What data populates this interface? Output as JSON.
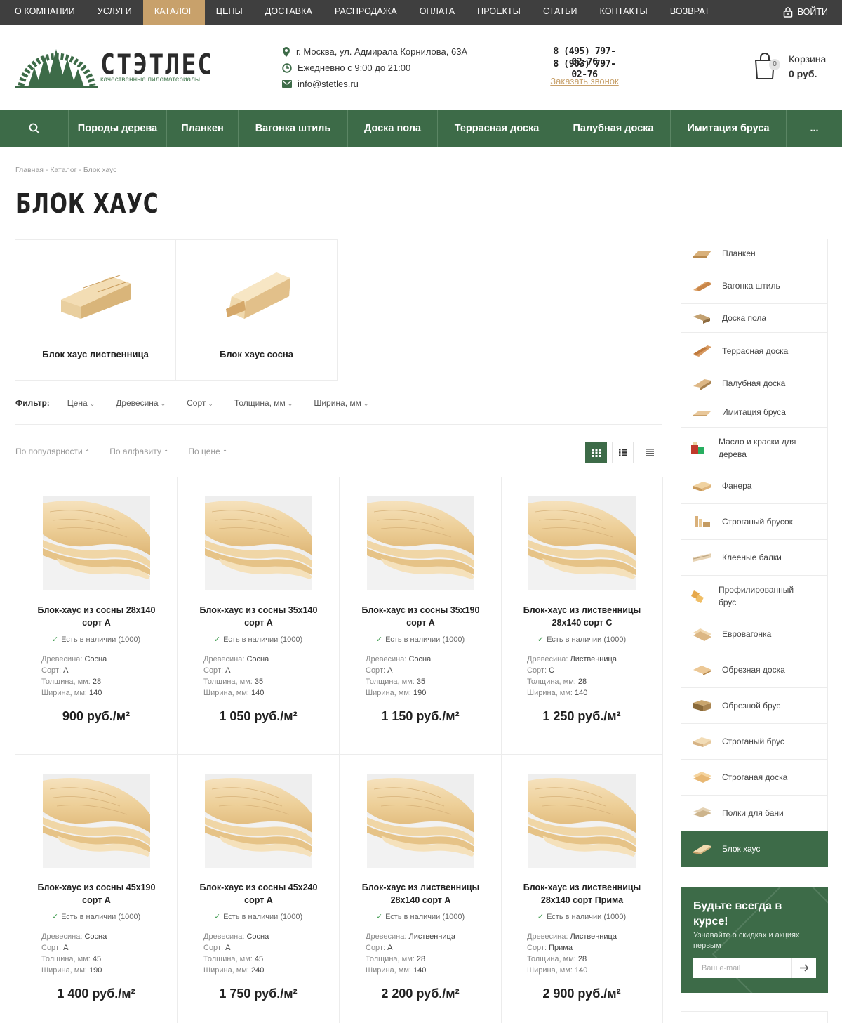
{
  "topnav": {
    "items": [
      "О КОМПАНИИ",
      "УСЛУГИ",
      "КАТАЛОГ",
      "ЦЕНЫ",
      "ДОСТАВКА",
      "РАСПРОДАЖА",
      "ОПЛАТА",
      "ПРОЕКТЫ",
      "СТАТЬИ",
      "КОНТАКТЫ",
      "ВОЗВРАТ"
    ],
    "active": "КАТАЛОГ",
    "login": "ВОЙТИ"
  },
  "header": {
    "logo_name": "СТЭТЛЕС",
    "logo_tagline": "качественные пиломатериалы",
    "address": "г. Москва, ул. Адмирала Корнилова, 63А",
    "hours": "Ежедневно с 9:00 до 21:00",
    "email": "info@stetles.ru",
    "phone1": "8 (495) 797-02-76",
    "phone2": "8 (903) 797-02-76",
    "callback": "Заказать звонок",
    "cart_label": "Корзина",
    "cart_sum": "0 руб.",
    "cart_count": "0"
  },
  "mainnav": {
    "items": [
      "Породы дерева",
      "Планкен",
      "Вагонка штиль",
      "Доска пола",
      "Террасная доска",
      "Палубная доска",
      "Имитация бруса"
    ],
    "more": "..."
  },
  "breadcrumb": [
    "Главная",
    "Каталог",
    "Блок хаус"
  ],
  "breadcrumb_sep": "-",
  "page_title": "БЛОК ХАУС",
  "subcategories": [
    "Блок хаус лиственница",
    "Блок хаус сосна"
  ],
  "filter": {
    "label": "Фильтр:",
    "items": [
      "Цена",
      "Древесина",
      "Сорт",
      "Толщина, мм",
      "Ширина, мм"
    ]
  },
  "sort": [
    "По популярности",
    "По алфавиту",
    "По цене"
  ],
  "labels": {
    "wood": "Древесина:",
    "grade": "Сорт:",
    "thickness": "Толщина, мм:",
    "width": "Ширина, мм:"
  },
  "products": [
    {
      "name": "Блок-хаус из сосны 28х140 сорт А",
      "stock": "Есть в наличии (1000)",
      "wood": "Сосна",
      "grade": "А",
      "thickness": "28",
      "width": "140",
      "price": "900 руб./м²"
    },
    {
      "name": "Блок-хаус из сосны 35х140 сорт А",
      "stock": "Есть в наличии (1000)",
      "wood": "Сосна",
      "grade": "А",
      "thickness": "35",
      "width": "140",
      "price": "1 050 руб./м²"
    },
    {
      "name": "Блок-хаус из сосны 35х190 сорт А",
      "stock": "Есть в наличии (1000)",
      "wood": "Сосна",
      "grade": "А",
      "thickness": "35",
      "width": "190",
      "price": "1 150 руб./м²"
    },
    {
      "name": "Блок-хаус из лиственницы 28х140 сорт С",
      "stock": "Есть в наличии (1000)",
      "wood": "Лиственница",
      "grade": "С",
      "thickness": "28",
      "width": "140",
      "price": "1 250 руб./м²"
    },
    {
      "name": "Блок-хаус из сосны 45х190 сорт А",
      "stock": "Есть в наличии (1000)",
      "wood": "Сосна",
      "grade": "А",
      "thickness": "45",
      "width": "190",
      "price": "1 400 руб./м²"
    },
    {
      "name": "Блок-хаус из сосны 45х240 сорт А",
      "stock": "Есть в наличии (1000)",
      "wood": "Сосна",
      "grade": "А",
      "thickness": "45",
      "width": "240",
      "price": "1 750 руб./м²"
    },
    {
      "name": "Блок-хаус из лиственницы 28х140 сорт А",
      "stock": "Есть в наличии (1000)",
      "wood": "Лиственница",
      "grade": "А",
      "thickness": "28",
      "width": "140",
      "price": "2 200 руб./м²"
    },
    {
      "name": "Блок-хаус из лиственницы 28х140 сорт Прима",
      "stock": "Есть в наличии (1000)",
      "wood": "Лиственница",
      "grade": "Прима",
      "thickness": "28",
      "width": "140",
      "price": "2 900 руб./м²"
    }
  ],
  "sidebar": {
    "items": [
      "Планкен",
      "Вагонка штиль",
      "Доска пола",
      "Террасная доска",
      "Палубная доска",
      "Имитация бруса",
      "Масло и краски для дерева",
      "Фанера",
      "Строганый брусок",
      "Клееные балки",
      "Профилированный брус",
      "Евровагонка",
      "Обрезная доска",
      "Обрезной брус",
      "Строганый брус",
      "Строганая доска",
      "Полки для бани",
      "Блок хаус"
    ],
    "active": "Блок хаус"
  },
  "subscribe": {
    "title": "Будьте всегда в курсе!",
    "text": "Узнавайте о скидках и акциях первым",
    "placeholder": "Ваш e-mail"
  },
  "colors": {
    "green": "#3d6b48",
    "topbar": "#3f3f3f",
    "accent": "#c8a16b"
  }
}
